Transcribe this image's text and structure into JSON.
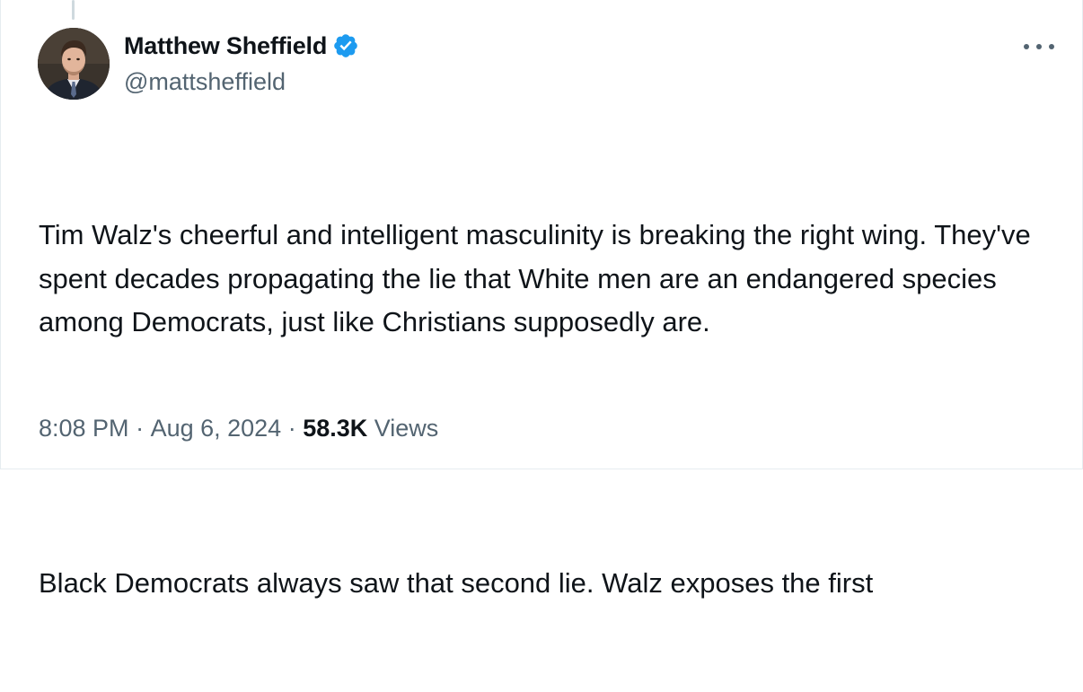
{
  "tweet": {
    "author": {
      "display_name": "Matthew Sheffield",
      "handle": "@mattsheffield",
      "verified": true,
      "avatar_icon": "profile-photo"
    },
    "text": {
      "paragraph_1": "Tim Walz's cheerful and intelligent masculinity is breaking the right wing. They've spent decades propagating the lie that White men are an endangered species among Democrats, just like Christians supposedly are.",
      "paragraph_2": "Black Democrats always saw that second lie. Walz exposes the first"
    },
    "meta": {
      "time": "8:08 PM",
      "separator_1": " · ",
      "date": "Aug 6, 2024",
      "separator_2": " · ",
      "views_count": "58.3K",
      "views_label": " Views"
    },
    "more_icon": "ellipsis-icon"
  },
  "colors": {
    "text_primary": "#0f1419",
    "text_secondary": "#536471",
    "verified_blue": "#1d9bf0",
    "border": "#e6ecf0"
  }
}
